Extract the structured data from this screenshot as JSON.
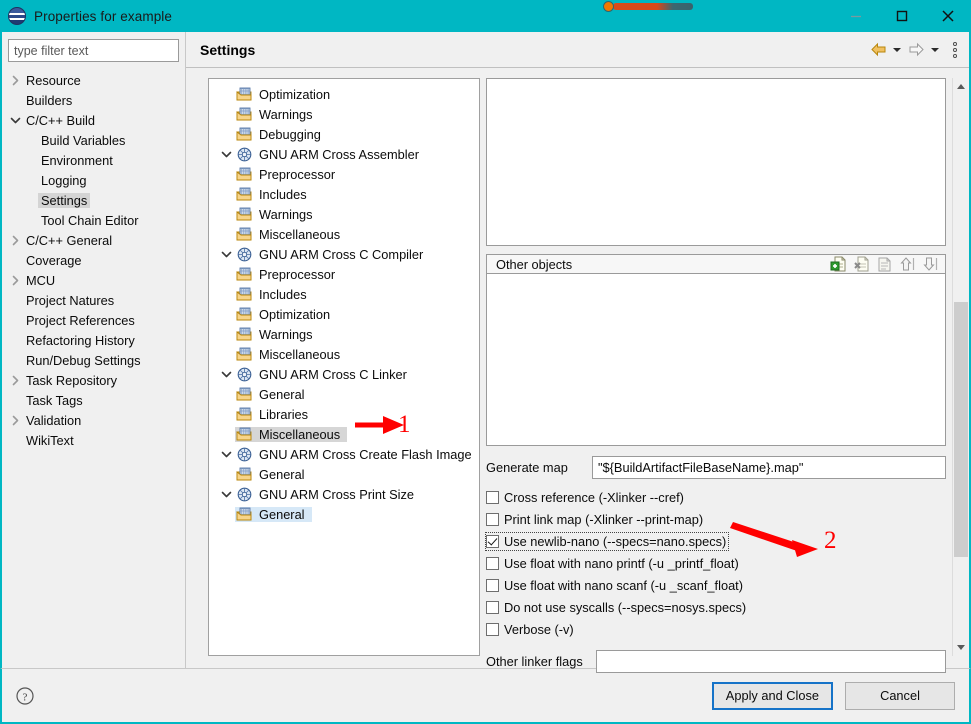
{
  "window": {
    "title": "Properties for example",
    "title_icon": "eclipse-icon",
    "controls": {
      "minimize": "minimize-icon",
      "maximize": "maximize-icon",
      "close": "close-icon"
    }
  },
  "left_nav": {
    "filter_placeholder": "type filter text",
    "filter_value": "",
    "items": [
      {
        "label": "Resource",
        "indent": 0,
        "twisty": "collapsed",
        "selected": false
      },
      {
        "label": "Builders",
        "indent": 0,
        "twisty": "none",
        "selected": false
      },
      {
        "label": "C/C++ Build",
        "indent": 0,
        "twisty": "expanded",
        "selected": false
      },
      {
        "label": "Build Variables",
        "indent": 1,
        "twisty": "none",
        "selected": false
      },
      {
        "label": "Environment",
        "indent": 1,
        "twisty": "none",
        "selected": false
      },
      {
        "label": "Logging",
        "indent": 1,
        "twisty": "none",
        "selected": false
      },
      {
        "label": "Settings",
        "indent": 1,
        "twisty": "none",
        "selected": true
      },
      {
        "label": "Tool Chain Editor",
        "indent": 1,
        "twisty": "none",
        "selected": false
      },
      {
        "label": "C/C++ General",
        "indent": 0,
        "twisty": "collapsed",
        "selected": false
      },
      {
        "label": "Coverage",
        "indent": 0,
        "twisty": "none",
        "selected": false
      },
      {
        "label": "MCU",
        "indent": 0,
        "twisty": "collapsed",
        "selected": false
      },
      {
        "label": "Project Natures",
        "indent": 0,
        "twisty": "none",
        "selected": false
      },
      {
        "label": "Project References",
        "indent": 0,
        "twisty": "none",
        "selected": false
      },
      {
        "label": "Refactoring History",
        "indent": 0,
        "twisty": "none",
        "selected": false
      },
      {
        "label": "Run/Debug Settings",
        "indent": 0,
        "twisty": "none",
        "selected": false
      },
      {
        "label": "Task Repository",
        "indent": 0,
        "twisty": "collapsed",
        "selected": false
      },
      {
        "label": "Task Tags",
        "indent": 0,
        "twisty": "none",
        "selected": false
      },
      {
        "label": "Validation",
        "indent": 0,
        "twisty": "collapsed",
        "selected": false
      },
      {
        "label": "WikiText",
        "indent": 0,
        "twisty": "none",
        "selected": false
      }
    ]
  },
  "page": {
    "title": "Settings",
    "nav": {
      "back_icon": "back-arrow-icon",
      "back_dropdown_icon": "chevron-down-icon",
      "forward_icon": "forward-arrow-icon",
      "forward_dropdown_icon": "chevron-down-icon",
      "view_menu_icon": "view-menu-icon"
    }
  },
  "tool_tree": {
    "items": [
      {
        "label": "Optimization",
        "level": 2,
        "icon": "option-page-icon",
        "twisty": "none",
        "state": "normal"
      },
      {
        "label": "Warnings",
        "level": 2,
        "icon": "option-page-icon",
        "twisty": "none",
        "state": "normal"
      },
      {
        "label": "Debugging",
        "level": 2,
        "icon": "option-page-icon",
        "twisty": "none",
        "state": "normal"
      },
      {
        "label": "GNU ARM Cross Assembler",
        "level": 1,
        "icon": "tool-icon",
        "twisty": "expanded",
        "state": "normal"
      },
      {
        "label": "Preprocessor",
        "level": 2,
        "icon": "option-page-icon",
        "twisty": "none",
        "state": "normal"
      },
      {
        "label": "Includes",
        "level": 2,
        "icon": "option-page-icon",
        "twisty": "none",
        "state": "normal"
      },
      {
        "label": "Warnings",
        "level": 2,
        "icon": "option-page-icon",
        "twisty": "none",
        "state": "normal"
      },
      {
        "label": "Miscellaneous",
        "level": 2,
        "icon": "option-page-icon",
        "twisty": "none",
        "state": "normal"
      },
      {
        "label": "GNU ARM Cross C Compiler",
        "level": 1,
        "icon": "tool-icon",
        "twisty": "expanded",
        "state": "normal"
      },
      {
        "label": "Preprocessor",
        "level": 2,
        "icon": "option-page-icon",
        "twisty": "none",
        "state": "normal"
      },
      {
        "label": "Includes",
        "level": 2,
        "icon": "option-page-icon",
        "twisty": "none",
        "state": "normal"
      },
      {
        "label": "Optimization",
        "level": 2,
        "icon": "option-page-icon",
        "twisty": "none",
        "state": "normal"
      },
      {
        "label": "Warnings",
        "level": 2,
        "icon": "option-page-icon",
        "twisty": "none",
        "state": "normal"
      },
      {
        "label": "Miscellaneous",
        "level": 2,
        "icon": "option-page-icon",
        "twisty": "none",
        "state": "normal"
      },
      {
        "label": "GNU ARM Cross C Linker",
        "level": 1,
        "icon": "tool-icon",
        "twisty": "expanded",
        "state": "normal"
      },
      {
        "label": "General",
        "level": 2,
        "icon": "option-page-icon",
        "twisty": "none",
        "state": "normal"
      },
      {
        "label": "Libraries",
        "level": 2,
        "icon": "option-page-icon",
        "twisty": "none",
        "state": "normal"
      },
      {
        "label": "Miscellaneous",
        "level": 2,
        "icon": "option-page-icon",
        "twisty": "none",
        "state": "highlight"
      },
      {
        "label": "GNU ARM Cross Create Flash Image",
        "level": 1,
        "icon": "tool-icon",
        "twisty": "expanded",
        "state": "normal"
      },
      {
        "label": "General",
        "level": 2,
        "icon": "option-page-icon",
        "twisty": "none",
        "state": "normal"
      },
      {
        "label": "GNU ARM Cross Print Size",
        "level": 1,
        "icon": "tool-icon",
        "twisty": "expanded",
        "state": "normal"
      },
      {
        "label": "General",
        "level": 2,
        "icon": "option-page-icon",
        "twisty": "none",
        "state": "selected"
      }
    ]
  },
  "settings": {
    "top_list_items": [],
    "other_objects": {
      "title": "Other objects",
      "items": [],
      "tools": [
        {
          "name": "add-icon",
          "title": "Add"
        },
        {
          "name": "delete-icon",
          "title": "Delete"
        },
        {
          "name": "edit-icon",
          "title": "Edit"
        },
        {
          "name": "move-up-icon",
          "title": "Move Up"
        },
        {
          "name": "move-down-icon",
          "title": "Move Down"
        }
      ]
    },
    "generate_map": {
      "label": "Generate map",
      "value": "\"${BuildArtifactFileBaseName}.map\""
    },
    "checkboxes": [
      {
        "label": "Cross reference (-Xlinker --cref)",
        "checked": false,
        "focused": false
      },
      {
        "label": "Print link map (-Xlinker --print-map)",
        "checked": false,
        "focused": false
      },
      {
        "label": "Use newlib-nano (--specs=nano.specs)",
        "checked": true,
        "focused": true
      },
      {
        "label": "Use float with nano printf (-u _printf_float)",
        "checked": false,
        "focused": false
      },
      {
        "label": "Use float with nano scanf (-u _scanf_float)",
        "checked": false,
        "focused": false
      },
      {
        "label": "Do not use syscalls (--specs=nosys.specs)",
        "checked": false,
        "focused": false
      },
      {
        "label": "Verbose (-v)",
        "checked": false,
        "focused": false
      }
    ],
    "other_linker_flags": {
      "label": "Other linker flags",
      "value": ""
    }
  },
  "scrollbar": {
    "up_icon": "scroll-up-icon",
    "down_icon": "scroll-down-icon"
  },
  "footer": {
    "help_icon": "help-icon",
    "apply_and_close_label": "Apply and Close",
    "cancel_label": "Cancel"
  },
  "annotations": [
    {
      "number": "1",
      "color": "#ff0000"
    },
    {
      "number": "2",
      "color": "#ff0000"
    }
  ],
  "colors": {
    "title_bar": "#00b7c3",
    "dialog_bg": "#f0f0f0",
    "annotation_red": "#ff0000",
    "focus_blue": "#1673c8",
    "selection_blue": "#d6e8f7",
    "highlight_gray": "#d6d6d6"
  }
}
